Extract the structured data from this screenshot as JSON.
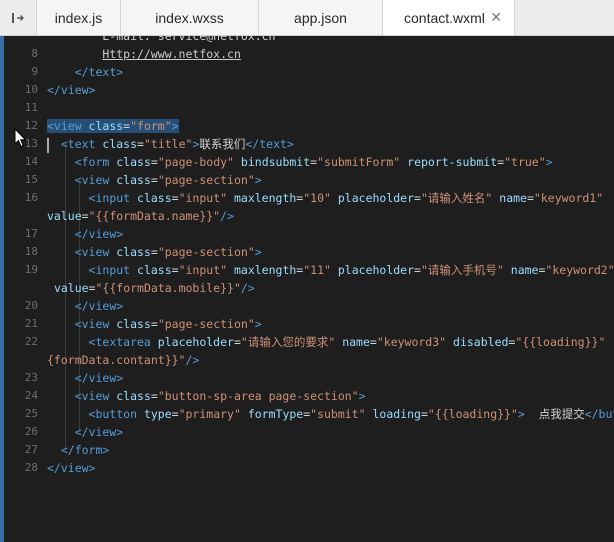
{
  "tabbar": {
    "toggle_icon": "sidebar-toggle-icon",
    "tabs": [
      {
        "label": "index.js",
        "active": false
      },
      {
        "label": "index.wxss",
        "active": false
      },
      {
        "label": "app.json",
        "active": false
      },
      {
        "label": "contact.wxml",
        "active": true,
        "close": "✕"
      }
    ]
  },
  "editor": {
    "lines": [
      {
        "n": "",
        "parts": [
          [
            "txt",
            "        E-mail: service@netfox.cn"
          ]
        ]
      },
      {
        "n": "8",
        "parts": [
          [
            "txt",
            "        "
          ],
          [
            "link",
            "Http://www.netfox.cn"
          ]
        ]
      },
      {
        "n": "9",
        "parts": [
          [
            "txt",
            "    "
          ],
          [
            "tag",
            "</text>"
          ]
        ]
      },
      {
        "n": "10",
        "parts": [
          [
            "tag",
            "</view>"
          ]
        ]
      },
      {
        "n": "11",
        "parts": []
      },
      {
        "n": "12",
        "sel": true,
        "parts": [
          [
            "tag",
            "<view "
          ],
          [
            "attr",
            "class"
          ],
          [
            "txt",
            "="
          ],
          [
            "str",
            "\"form\""
          ],
          [
            "tag",
            ">"
          ]
        ]
      },
      {
        "n": "13",
        "parts": [
          [
            "txt",
            "  "
          ],
          [
            "tag",
            "<text "
          ],
          [
            "attr",
            "class"
          ],
          [
            "txt",
            "="
          ],
          [
            "str",
            "\"title\""
          ],
          [
            "tag",
            ">"
          ],
          [
            "txt",
            "联系我们"
          ],
          [
            "tag",
            "</text>"
          ]
        ]
      },
      {
        "n": "14",
        "parts": [
          [
            "txt",
            "    "
          ],
          [
            "tag",
            "<form "
          ],
          [
            "attr",
            "class"
          ],
          [
            "txt",
            "="
          ],
          [
            "str",
            "\"page-body\""
          ],
          [
            "txt",
            " "
          ],
          [
            "attr",
            "bindsubmit"
          ],
          [
            "txt",
            "="
          ],
          [
            "str",
            "\"submitForm\""
          ],
          [
            "txt",
            " "
          ],
          [
            "attr",
            "report-submit"
          ],
          [
            "txt",
            "="
          ],
          [
            "str",
            "\"true\""
          ],
          [
            "tag",
            ">"
          ]
        ]
      },
      {
        "n": "15",
        "parts": [
          [
            "txt",
            "    "
          ],
          [
            "tag",
            "<view "
          ],
          [
            "attr",
            "class"
          ],
          [
            "txt",
            "="
          ],
          [
            "str",
            "\"page-section\""
          ],
          [
            "tag",
            ">"
          ]
        ]
      },
      {
        "n": "16",
        "parts": [
          [
            "txt",
            "      "
          ],
          [
            "tag",
            "<input "
          ],
          [
            "attr",
            "class"
          ],
          [
            "txt",
            "="
          ],
          [
            "str",
            "\"input\""
          ],
          [
            "txt",
            " "
          ],
          [
            "attr",
            "maxlength"
          ],
          [
            "txt",
            "="
          ],
          [
            "str",
            "\"10\""
          ],
          [
            "txt",
            " "
          ],
          [
            "attr",
            "placeholder"
          ],
          [
            "txt",
            "="
          ],
          [
            "str",
            "\"请输入姓名\""
          ],
          [
            "txt",
            " "
          ],
          [
            "attr",
            "name"
          ],
          [
            "txt",
            "="
          ],
          [
            "str",
            "\"keyword1\""
          ]
        ]
      },
      {
        "n": "",
        "parts": [
          [
            "attr",
            "value"
          ],
          [
            "txt",
            "="
          ],
          [
            "str",
            "\"{{formData.name}}\""
          ],
          [
            "tag",
            "/>"
          ]
        ]
      },
      {
        "n": "17",
        "parts": [
          [
            "txt",
            "    "
          ],
          [
            "tag",
            "</view>"
          ]
        ]
      },
      {
        "n": "18",
        "parts": [
          [
            "txt",
            "    "
          ],
          [
            "tag",
            "<view "
          ],
          [
            "attr",
            "class"
          ],
          [
            "txt",
            "="
          ],
          [
            "str",
            "\"page-section\""
          ],
          [
            "tag",
            ">"
          ]
        ]
      },
      {
        "n": "19",
        "parts": [
          [
            "txt",
            "      "
          ],
          [
            "tag",
            "<input "
          ],
          [
            "attr",
            "class"
          ],
          [
            "txt",
            "="
          ],
          [
            "str",
            "\"input\""
          ],
          [
            "txt",
            " "
          ],
          [
            "attr",
            "maxlength"
          ],
          [
            "txt",
            "="
          ],
          [
            "str",
            "\"11\""
          ],
          [
            "txt",
            " "
          ],
          [
            "attr",
            "placeholder"
          ],
          [
            "txt",
            "="
          ],
          [
            "str",
            "\"请输入手机号\""
          ],
          [
            "txt",
            " "
          ],
          [
            "attr",
            "name"
          ],
          [
            "txt",
            "="
          ],
          [
            "str",
            "\"keyword2\""
          ]
        ]
      },
      {
        "n": "",
        "parts": [
          [
            "txt",
            " "
          ],
          [
            "attr",
            "value"
          ],
          [
            "txt",
            "="
          ],
          [
            "str",
            "\"{{formData.mobile}}\""
          ],
          [
            "tag",
            "/>"
          ]
        ]
      },
      {
        "n": "20",
        "parts": [
          [
            "txt",
            "    "
          ],
          [
            "tag",
            "</view>"
          ]
        ]
      },
      {
        "n": "21",
        "parts": [
          [
            "txt",
            "    "
          ],
          [
            "tag",
            "<view "
          ],
          [
            "attr",
            "class"
          ],
          [
            "txt",
            "="
          ],
          [
            "str",
            "\"page-section\""
          ],
          [
            "tag",
            ">"
          ]
        ]
      },
      {
        "n": "22",
        "parts": [
          [
            "txt",
            "      "
          ],
          [
            "tag",
            "<textarea "
          ],
          [
            "attr",
            "placeholder"
          ],
          [
            "txt",
            "="
          ],
          [
            "str",
            "\"请输入您的要求\""
          ],
          [
            "txt",
            " "
          ],
          [
            "attr",
            "name"
          ],
          [
            "txt",
            "="
          ],
          [
            "str",
            "\"keyword3\""
          ],
          [
            "txt",
            " "
          ],
          [
            "attr",
            "disabled"
          ],
          [
            "txt",
            "="
          ],
          [
            "str",
            "\"{{loading}}\""
          ]
        ]
      },
      {
        "n": "",
        "parts": [
          [
            "str",
            "{formData.contant}}\""
          ],
          [
            "tag",
            "/>"
          ]
        ]
      },
      {
        "n": "23",
        "parts": [
          [
            "txt",
            "    "
          ],
          [
            "tag",
            "</view>"
          ]
        ]
      },
      {
        "n": "24",
        "parts": [
          [
            "txt",
            "    "
          ],
          [
            "tag",
            "<view "
          ],
          [
            "attr",
            "class"
          ],
          [
            "txt",
            "="
          ],
          [
            "str",
            "\"button-sp-area page-section\""
          ],
          [
            "tag",
            ">"
          ]
        ]
      },
      {
        "n": "25",
        "parts": [
          [
            "txt",
            "      "
          ],
          [
            "tag",
            "<button "
          ],
          [
            "attr",
            "type"
          ],
          [
            "txt",
            "="
          ],
          [
            "str",
            "\"primary\""
          ],
          [
            "txt",
            " "
          ],
          [
            "attr",
            "formType"
          ],
          [
            "txt",
            "="
          ],
          [
            "str",
            "\"submit\""
          ],
          [
            "txt",
            " "
          ],
          [
            "attr",
            "loading"
          ],
          [
            "txt",
            "="
          ],
          [
            "str",
            "\"{{loading}}\""
          ],
          [
            "tag",
            ">"
          ],
          [
            "txt",
            "  点我提交"
          ],
          [
            "tag",
            "</button>"
          ]
        ]
      },
      {
        "n": "26",
        "parts": [
          [
            "txt",
            "    "
          ],
          [
            "tag",
            "</view>"
          ]
        ]
      },
      {
        "n": "27",
        "parts": [
          [
            "txt",
            "  "
          ],
          [
            "tag",
            "</form>"
          ]
        ]
      },
      {
        "n": "28",
        "parts": [
          [
            "tag",
            "</view>"
          ]
        ]
      }
    ]
  },
  "colors": {
    "background": "#1e1e1e",
    "tag": "#569cd6",
    "attribute": "#9cdcfe",
    "string": "#ce9178",
    "selection": "#264f78"
  },
  "cursor_icon": "mouse-pointer-icon"
}
